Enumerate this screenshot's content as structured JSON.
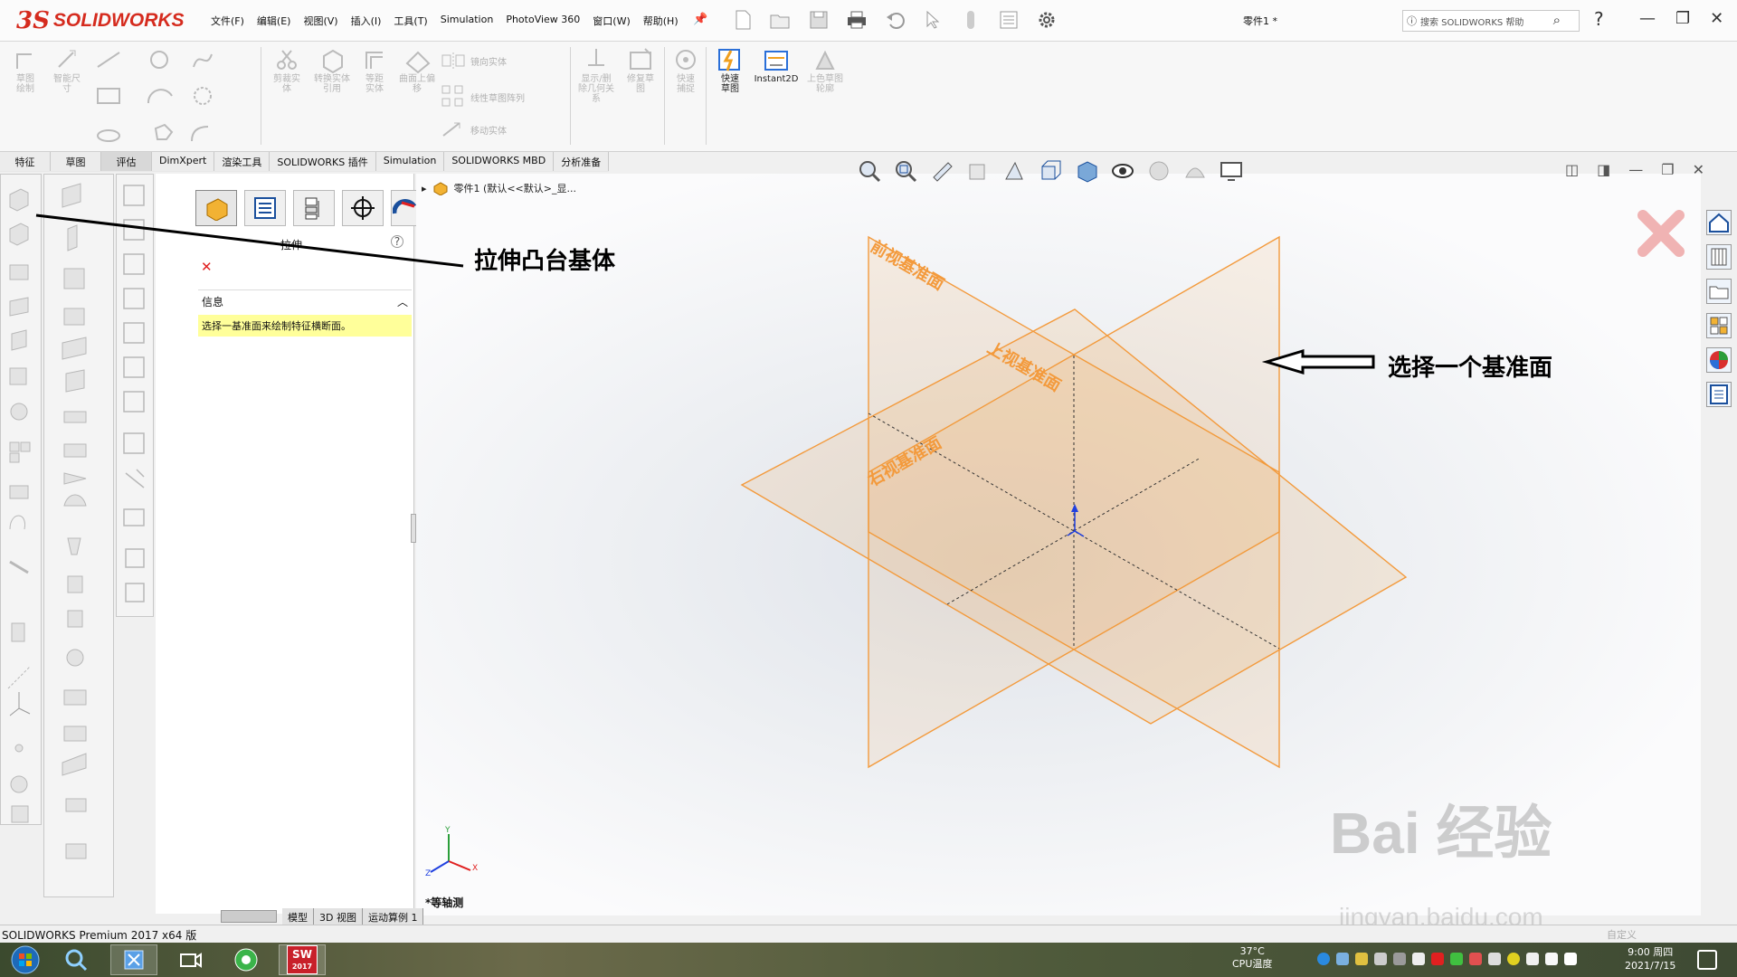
{
  "app": {
    "logo_mark": "3S",
    "logo_text": "SOLIDWORKS",
    "document_title": "零件1 *",
    "search_placeholder": "搜索 SOLIDWORKS 帮助"
  },
  "menu": [
    "文件(F)",
    "编辑(E)",
    "视图(V)",
    "插入(I)",
    "工具(T)",
    "Simulation",
    "PhotoView 360",
    "窗口(W)",
    "帮助(H)"
  ],
  "ribbon": {
    "sketch_draw": "草图绘制",
    "smart_dim": "智能尺寸",
    "trim": "剪裁实体",
    "convert": "转换实体引用",
    "offset": "等距实体",
    "surface_offset": "曲面上偏移",
    "mirror": "镜向实体",
    "linear_pattern": "线性草图阵列",
    "move": "移动实体",
    "display_relations": "显示/删除几何关系",
    "repair": "修复草图",
    "quick_snap": "快速捕捉",
    "rapid_sketch": "快速草图",
    "instant2d": "Instant2D",
    "shaded_contours": "上色草图轮廓"
  },
  "tabs": [
    "特征",
    "草图",
    "评估",
    "DimXpert",
    "渲染工具",
    "SOLIDWORKS 插件",
    "Simulation",
    "SOLIDWORKS MBD",
    "分析准备"
  ],
  "active_tab": "评估",
  "property_manager": {
    "title": "拉伸",
    "section_title": "信息",
    "message": "选择一基准面来绘制特征横断面。"
  },
  "tree_path": "零件1 (默认<<默认>_显...",
  "planes": {
    "front": "前视基准面",
    "top": "上视基准面",
    "right": "右视基准面"
  },
  "annotations": {
    "extrude": "拉伸凸台基体",
    "select_plane": "选择一个基准面"
  },
  "view_label": "*等轴测",
  "axes": {
    "x": "X",
    "y": "Y",
    "z": "Z"
  },
  "bottom_tabs": [
    "模型",
    "3D 视图",
    "运动算例 1"
  ],
  "status_text": "SOLIDWORKS Premium 2017 x64 版",
  "status_right": "自定义",
  "taskbar": {
    "temp": "37°C",
    "temp_label": "CPU温度",
    "time": "9:00 周四",
    "date": "2021/7/15",
    "sw_badge": "SW",
    "sw_year": "2017"
  },
  "watermark": {
    "logo": "Bai 经验",
    "url": "jingyan.baidu.com"
  },
  "colors": {
    "plane_orange": "#f39a3c",
    "brand_red": "#d52b1e",
    "info_yellow": "#ffff9a"
  }
}
